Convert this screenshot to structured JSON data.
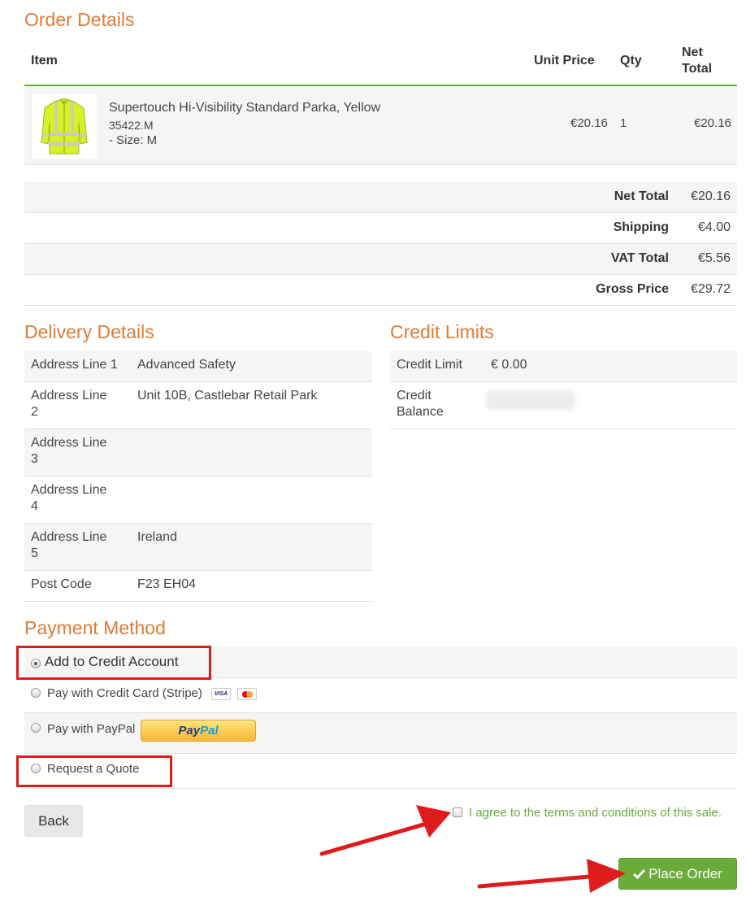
{
  "order": {
    "title": "Order Details",
    "headers": {
      "item": "Item",
      "unit_price": "Unit Price",
      "qty": "Qty",
      "net_total_1": "Net",
      "net_total_2": "Total"
    },
    "item": {
      "name": "Supertouch Hi-Visibility Standard Parka, Yellow",
      "code": "35422.M",
      "size": "- Size: M",
      "unit_price": "€20.16",
      "qty": "1",
      "net_total": "€20.16"
    },
    "totals": [
      {
        "label": "Net Total",
        "value": "€20.16"
      },
      {
        "label": "Shipping",
        "value": "€4.00"
      },
      {
        "label": "VAT Total",
        "value": "€5.56"
      },
      {
        "label": "Gross Price",
        "value": "€29.72"
      }
    ]
  },
  "delivery": {
    "title": "Delivery Details",
    "rows": [
      {
        "label": "Address Line 1",
        "label_2": "",
        "value": "Advanced Safety"
      },
      {
        "label": "Address Line",
        "label_2": "2",
        "value": "Unit 10B, Castlebar Retail Park"
      },
      {
        "label": "Address Line",
        "label_2": "3",
        "value": ""
      },
      {
        "label": "Address Line",
        "label_2": "4",
        "value": ""
      },
      {
        "label": "Address Line",
        "label_2": "5",
        "value": "Ireland"
      },
      {
        "label": "Post Code",
        "label_2": "",
        "value": "F23 EH04"
      }
    ]
  },
  "credit": {
    "title": "Credit Limits",
    "limit_label": "Credit Limit",
    "limit_value": "€ 0.00",
    "balance_label_1": "Credit",
    "balance_label_2": "Balance"
  },
  "payment": {
    "title": "Payment Method",
    "options": [
      {
        "label": "Add to Credit Account",
        "selected": true
      },
      {
        "label": "Pay with Credit Card (Stripe)",
        "selected": false
      },
      {
        "label": "Pay with PayPal",
        "selected": false
      },
      {
        "label": "Request a Quote",
        "selected": false
      }
    ],
    "visa_text": "VISA",
    "paypal_text_a": "Pay",
    "paypal_text_b": "Pal"
  },
  "actions": {
    "back": "Back",
    "agree": "I agree to the terms and conditions of this sale.",
    "place_order": "Place Order"
  },
  "colors": {
    "accent": "#e07b39",
    "green": "#6aab3a",
    "annotation_red": "#e01b1b"
  }
}
